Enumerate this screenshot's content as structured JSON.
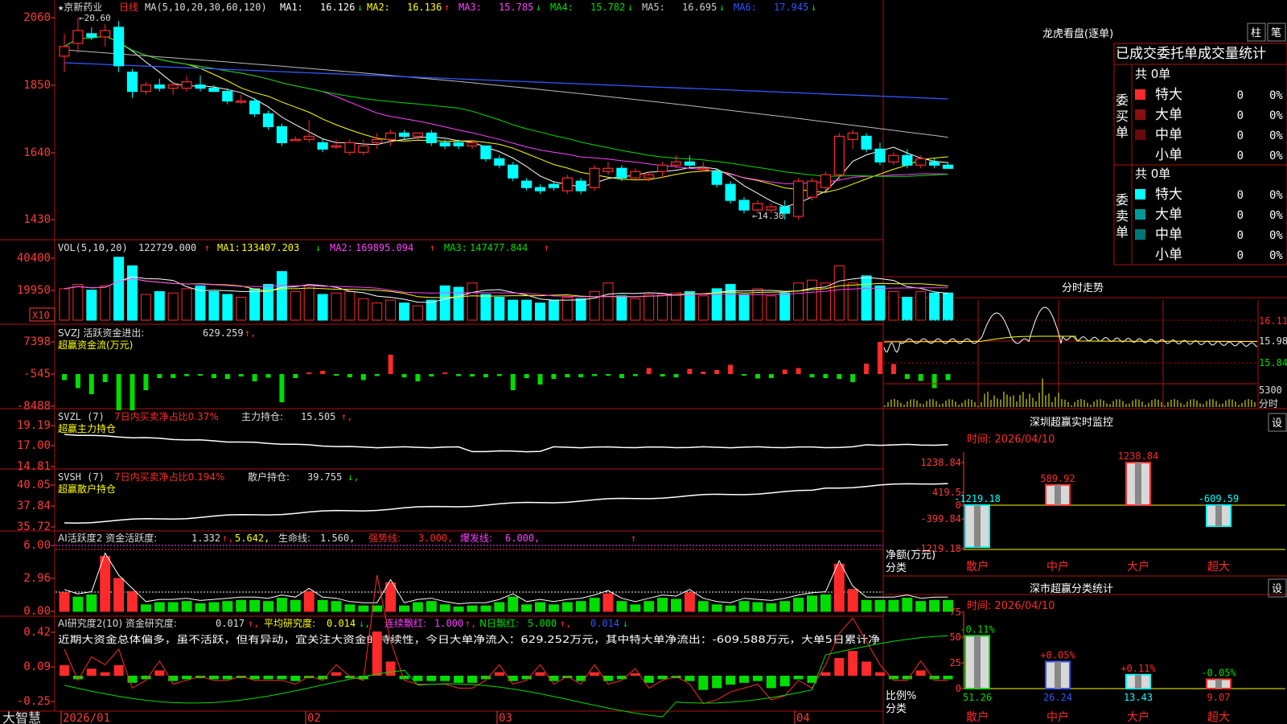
{
  "colors": {
    "red": "#ff2a2a",
    "green": "#00dd00",
    "cyan": "#00ffff",
    "yellow": "#ffff00",
    "magenta": "#ff40ff",
    "white": "#ffffff",
    "blue": "#3355ff",
    "gray": "#aaaaaa",
    "frame": "#b01010",
    "axis": "#ff3a3a"
  },
  "header": {
    "stock": "★京新药业",
    "period": "日线",
    "ma_def": "MA(5,10,20,30,60,120)",
    "ma": [
      {
        "label": "MA1:",
        "value": "16.126",
        "arrow": "↓",
        "color": "#ffffff"
      },
      {
        "label": "MA2:",
        "value": "16.136",
        "arrow": "↑",
        "color": "#ffff00"
      },
      {
        "label": "MA3:",
        "value": "15.785",
        "arrow": "↓",
        "color": "#ff40ff"
      },
      {
        "label": "MA4:",
        "value": "15.782",
        "arrow": "↓",
        "color": "#00dd00"
      },
      {
        "label": "MA5:",
        "value": "16.695",
        "arrow": "↓",
        "color": "#cccccc"
      },
      {
        "label": "MA6:",
        "value": "17.945",
        "arrow": "↓",
        "color": "#3355ff"
      }
    ]
  },
  "price_panel": {
    "ticks": [
      "2060",
      "1850",
      "1640",
      "1430"
    ],
    "high_mark": "←20.60",
    "low_mark": "←14.30"
  },
  "vol_panel": {
    "ticks": [
      "40400",
      "19950"
    ],
    "unit": "X10",
    "title": "VOL(5,10,20)",
    "vol": "122729.000",
    "vol_arrow": "↑",
    "ma": [
      {
        "label": "MA1:",
        "value": "133407.203",
        "arrow": "↓",
        "color": "#ffffff"
      },
      {
        "label": "MA2:",
        "value": "169895.094",
        "arrow": "↑",
        "color": "#ff40ff"
      },
      {
        "label": "MA3:",
        "value": "147477.844",
        "arrow": "↑",
        "color": "#00dd00"
      }
    ]
  },
  "svzj_panel": {
    "ticks": [
      "7398",
      "-545",
      "-8488"
    ],
    "title": "SVZJ  活跃资金进出:",
    "value": "629.259",
    "arrow": "↑,",
    "subtitle": "超赢资金流(万元)"
  },
  "svzl_panel": {
    "ticks": [
      "19.19",
      "17.00",
      "14.81"
    ],
    "title": "SVZL (7)",
    "red_text": "7日内买卖净占比0.37%",
    "label": "主力持仓:",
    "value": "15.505",
    "arrow": "↑,",
    "subtitle": "超赢主力持仓"
  },
  "svsh_panel": {
    "ticks": [
      "40.05",
      "37.84",
      "35.72"
    ],
    "title": "SVSH (7)",
    "red_text": "7日内买卖净占比0.194%",
    "label": "散户持仓:",
    "value": "39.755",
    "arrow": "↓,",
    "subtitle": "超赢散户持仓"
  },
  "ai_panel": {
    "ticks": [
      "6.00",
      "2.96",
      "0.00"
    ],
    "title": "AI活跃度2 资金活跃度:",
    "v1": "1.332",
    "a1": "↑,",
    "v2": "5.642,",
    "label3": "生命线:",
    "v3": "1.560,",
    "l4": "强势线:",
    "v4": "3.000,",
    "l5": "爆发线:",
    "v5": "6.000,",
    "mark": "↑"
  },
  "ai2_panel": {
    "ticks": [
      "0.42",
      "0.09",
      "-0.25"
    ],
    "title": "AI研究度2(10) 资金研究度:",
    "v1": "0.017",
    "a1": "↑,",
    "l2": "平均研究度:",
    "v2": "0.014",
    "a2": "↓,",
    "l3": "连续飘红:",
    "v3": "1.000",
    "a3": "↑,",
    "l4": "N日飘红:",
    "v4": "5.000",
    "a4": "↑,",
    "v5": "0.014",
    "a5": "↓",
    "comment": "近期大资金总体偏多，虽不活跃，但有异动，宜关注大资金的持续性，今日大单净流入：629.252万元，其中特大单净流出：-609.588万元，大单5日累计净"
  },
  "dates": [
    "2026/01",
    "02",
    "03",
    "04"
  ],
  "brand": "大智慧",
  "right": {
    "lhkp_title": "龙虎看盘(逐单)",
    "btn1": "柱",
    "btn2": "笔",
    "stat_title": "已成交委托单成交量统计",
    "buy_total": "共 0单",
    "sell_total": "共 0单",
    "buy_side": [
      "委",
      "买",
      "单"
    ],
    "sell_side": [
      "委",
      "卖",
      "单"
    ],
    "buy_rows": [
      {
        "label": "特大",
        "v": "0",
        "p": "0%",
        "color": "#ff2a2a"
      },
      {
        "label": "大单",
        "v": "0",
        "p": "0%",
        "color": "#8a1010"
      },
      {
        "label": "中单",
        "v": "0",
        "p": "0%",
        "color": "#6a0a0a"
      },
      {
        "label": "小单",
        "v": "0",
        "p": "0%",
        "color": ""
      }
    ],
    "sell_rows": [
      {
        "label": "特大",
        "v": "0",
        "p": "0%",
        "color": "#00ffff"
      },
      {
        "label": "大单",
        "v": "0",
        "p": "0%",
        "color": "#009999"
      },
      {
        "label": "中单",
        "v": "0",
        "p": "0%",
        "color": "#007777"
      },
      {
        "label": "小单",
        "v": "0",
        "p": "0%",
        "color": ""
      }
    ],
    "fs_title": "分时走势",
    "fs_ticks": [
      "16.11",
      "15.98",
      "15.84"
    ],
    "fs_vol": "5300",
    "fs_vol_label": "分时",
    "sz_title": "深圳超赢实时监控",
    "sz_btn": "设",
    "sz_time": "时间: 2026/04/10",
    "sz_ticks": [
      "1238.84",
      "419.5",
      "0",
      "-399.84",
      "-1219.18"
    ],
    "sz_ylabel": "净额(万元)",
    "sz_xlabel": "分类",
    "sz_cats": [
      "散户",
      "中户",
      "大户",
      "超大"
    ],
    "sz_values": [
      -1219.18,
      589.92,
      1238.84,
      -609.59
    ],
    "sz_labels": [
      "-1219.18",
      "589.92",
      "1238.84",
      "-609.59"
    ],
    "fl_title": "深市超赢分类统计",
    "fl_btn": "设",
    "fl_time": "时间: 2026/04/10",
    "fl_ticks": [
      "75",
      "50",
      "25",
      "0"
    ],
    "fl_ylabel": "比例%",
    "fl_xlabel": "分类",
    "fl_cats": [
      "散户",
      "中户",
      "大户",
      "超大"
    ],
    "fl_values": [
      51.26,
      26.24,
      13.43,
      9.07
    ],
    "fl_value_labels": [
      "51.26",
      "26.24",
      "13.43",
      "9.07"
    ],
    "fl_change": [
      "-0.11%",
      "+0.05%",
      "+0.11%",
      "-0.05%"
    ]
  },
  "chart_data": [
    {
      "type": "candlestick",
      "title": "京新药业 日线",
      "ylim": [
        14.0,
        20.8
      ],
      "y_ticks": [
        20.6,
        18.5,
        16.4,
        14.3
      ],
      "ohlc": [
        [
          19.4,
          20.1,
          18.9,
          19.7
        ],
        [
          19.8,
          20.6,
          19.5,
          20.2
        ],
        [
          20.1,
          20.3,
          19.9,
          20.0
        ],
        [
          20.0,
          20.4,
          19.7,
          20.2
        ],
        [
          20.3,
          20.5,
          18.9,
          19.1
        ],
        [
          18.9,
          19.0,
          18.1,
          18.3
        ],
        [
          18.3,
          18.6,
          18.2,
          18.5
        ],
        [
          18.5,
          18.7,
          18.3,
          18.4
        ],
        [
          18.4,
          18.6,
          18.2,
          18.5
        ],
        [
          18.4,
          18.8,
          18.3,
          18.6
        ],
        [
          18.5,
          18.8,
          18.3,
          18.4
        ],
        [
          18.4,
          18.5,
          18.3,
          18.3
        ],
        [
          18.3,
          18.4,
          17.9,
          18.0
        ],
        [
          18.0,
          18.2,
          17.9,
          18.0
        ],
        [
          18.0,
          18.1,
          17.5,
          17.6
        ],
        [
          17.6,
          17.7,
          17.1,
          17.2
        ],
        [
          17.2,
          17.3,
          16.6,
          16.7
        ],
        [
          16.8,
          16.9,
          16.8,
          16.8
        ],
        [
          16.8,
          17.4,
          16.7,
          16.9
        ],
        [
          16.7,
          16.8,
          16.4,
          16.5
        ],
        [
          16.6,
          16.8,
          16.5,
          16.6
        ],
        [
          16.4,
          16.8,
          16.3,
          16.7
        ],
        [
          16.4,
          16.8,
          16.3,
          16.6
        ],
        [
          16.7,
          17.0,
          16.5,
          16.8
        ],
        [
          16.8,
          17.1,
          16.6,
          17.0
        ],
        [
          17.0,
          17.1,
          16.8,
          16.9
        ],
        [
          16.9,
          17.0,
          16.8,
          17.0
        ],
        [
          17.0,
          17.1,
          16.6,
          16.7
        ],
        [
          16.7,
          16.8,
          16.5,
          16.6
        ],
        [
          16.7,
          16.8,
          16.5,
          16.6
        ],
        [
          16.6,
          16.8,
          16.5,
          16.7
        ],
        [
          16.6,
          16.6,
          16.1,
          16.2
        ],
        [
          16.2,
          16.3,
          15.9,
          16.0
        ],
        [
          16.0,
          16.1,
          15.5,
          15.6
        ],
        [
          15.5,
          15.6,
          15.2,
          15.3
        ],
        [
          15.3,
          15.4,
          15.1,
          15.2
        ],
        [
          15.4,
          15.5,
          15.2,
          15.3
        ],
        [
          15.2,
          15.7,
          15.1,
          15.6
        ],
        [
          15.5,
          15.6,
          15.1,
          15.2
        ],
        [
          15.3,
          16.0,
          15.2,
          15.9
        ],
        [
          15.8,
          16.1,
          15.7,
          15.9
        ],
        [
          15.9,
          16.0,
          15.5,
          15.6
        ],
        [
          15.6,
          15.9,
          15.5,
          15.8
        ],
        [
          15.6,
          15.8,
          15.5,
          15.7
        ],
        [
          15.8,
          16.1,
          15.6,
          16.0
        ],
        [
          16.0,
          16.3,
          15.9,
          16.1
        ],
        [
          16.1,
          16.3,
          15.9,
          16.0
        ],
        [
          15.9,
          16.1,
          15.8,
          15.9
        ],
        [
          15.8,
          15.9,
          15.3,
          15.4
        ],
        [
          15.4,
          15.5,
          14.8,
          14.9
        ],
        [
          14.9,
          15.0,
          14.5,
          14.6
        ],
        [
          14.6,
          14.9,
          14.5,
          14.8
        ],
        [
          14.6,
          14.8,
          14.5,
          14.7
        ],
        [
          14.7,
          14.9,
          14.3,
          14.5
        ],
        [
          14.4,
          15.6,
          14.3,
          15.5
        ],
        [
          15.0,
          15.6,
          14.9,
          15.5
        ],
        [
          15.3,
          15.8,
          15.2,
          15.7
        ],
        [
          15.7,
          17.0,
          15.5,
          16.9
        ],
        [
          16.8,
          17.1,
          16.5,
          17.0
        ],
        [
          16.9,
          17.0,
          16.4,
          16.5
        ],
        [
          16.5,
          16.7,
          16.0,
          16.1
        ],
        [
          16.1,
          16.4,
          16.0,
          16.3
        ],
        [
          16.3,
          16.5,
          15.9,
          16.0
        ],
        [
          16.0,
          16.3,
          15.9,
          16.2
        ],
        [
          16.1,
          16.2,
          15.9,
          16.0
        ],
        [
          16.0,
          16.1,
          15.9,
          15.9
        ]
      ]
    },
    {
      "type": "bar",
      "title": "VOL(5,10,20)",
      "ylim": [
        0,
        45000
      ],
      "values": [
        22000,
        25000,
        21000,
        24000,
        44000,
        38000,
        18000,
        20000,
        19000,
        22000,
        24000,
        20000,
        18000,
        16000,
        22000,
        25000,
        34000,
        20000,
        24000,
        18000,
        19000,
        20000,
        15000,
        12000,
        14000,
        12000,
        10000,
        14000,
        24000,
        23000,
        26000,
        18000,
        16000,
        14000,
        14000,
        12000,
        14000,
        16000,
        15000,
        20000,
        26000,
        17000,
        15000,
        18000,
        18000,
        19000,
        20000,
        17000,
        22000,
        25000,
        18000,
        22000,
        17000,
        19000,
        26000,
        28000,
        26000,
        38000,
        26000,
        31000,
        24000,
        20000,
        16000,
        20000,
        19000,
        19000
      ]
    },
    {
      "type": "bar",
      "title": "SVZJ 活跃资金进出",
      "values": [
        -1500,
        -3500,
        -5000,
        -2000,
        -9000,
        -9000,
        -4000,
        -1000,
        -1000,
        -500,
        -400,
        -1000,
        -1200,
        -600,
        -1800,
        -900,
        -7000,
        -1000,
        300,
        800,
        -200,
        -800,
        -1500,
        -500,
        4800,
        -800,
        -1800,
        -600,
        400,
        -500,
        -600,
        -800,
        -500,
        -4000,
        -1000,
        -2600,
        -1200,
        -800,
        -800,
        -500,
        -300,
        -1000,
        -500,
        1500,
        -600,
        -800,
        1300,
        600,
        1000,
        2300,
        -300,
        -1100,
        -1000,
        1100,
        1500,
        -800,
        -1000,
        -1200,
        -2000,
        2600,
        8000,
        2500,
        -1200,
        -1700,
        -3500,
        -1500
      ]
    },
    {
      "type": "line",
      "title": "SVZL 主力持仓",
      "ylim": [
        14.81,
        19.19
      ],
      "last": 15.505
    },
    {
      "type": "line",
      "title": "SVSH 散户持仓",
      "ylim": [
        35.72,
        40.05
      ],
      "last": 39.755
    },
    {
      "type": "bar",
      "title": "AI活跃度2",
      "ylim": [
        0,
        6.5
      ],
      "values": [
        1.7,
        1.3,
        1.5,
        5.0,
        3.0,
        1.8,
        0.6,
        0.8,
        0.8,
        0.9,
        0.7,
        0.8,
        0.9,
        1.0,
        1.0,
        0.9,
        1.2,
        1.0,
        1.8,
        1.0,
        0.9,
        0.6,
        0.5,
        0.5,
        2.6,
        0.5,
        0.8,
        0.9,
        0.6,
        0.4,
        0.5,
        0.5,
        0.8,
        1.3,
        0.6,
        0.8,
        0.6,
        0.8,
        0.9,
        1.2,
        1.6,
        0.9,
        0.6,
        0.9,
        1.2,
        1.1,
        1.7,
        0.9,
        0.6,
        0.5,
        0.9,
        0.8,
        0.7,
        0.9,
        1.2,
        1.4,
        1.5,
        4.3,
        2.0,
        1.0,
        1.0,
        1.0,
        1.2,
        0.9,
        1.0,
        1.0
      ]
    },
    {
      "type": "bar",
      "title": "AI研究度2(10)",
      "ylim": [
        -0.25,
        0.42
      ],
      "values": [
        0.06,
        -0.02,
        0.04,
        0.02,
        0.06,
        -0.04,
        -0.02,
        0.03,
        -0.03,
        -0.02,
        -0.01,
        -0.02,
        -0.02,
        -0.01,
        -0.02,
        -0.02,
        -0.02,
        -0.03,
        -0.01,
        -0.02,
        0.02,
        -0.01,
        -0.02,
        0.25,
        0.08,
        -0.02,
        -0.03,
        -0.03,
        -0.03,
        -0.04,
        -0.04,
        -0.02,
        0.02,
        -0.03,
        -0.02,
        0.02,
        -0.03,
        -0.01,
        -0.03,
        0.02,
        -0.03,
        -0.02,
        0.01,
        -0.04,
        -0.02,
        -0.01,
        -0.03,
        -0.08,
        -0.07,
        -0.05,
        -0.04,
        -0.03,
        -0.07,
        -0.06,
        -0.02,
        -0.04,
        0.02,
        0.1,
        0.14,
        0.08,
        0.02,
        -0.02,
        -0.02,
        0.03,
        -0.02,
        -0.02
      ]
    },
    {
      "type": "bar",
      "title": "深圳超赢实时监控",
      "categories": [
        "散户",
        "中户",
        "大户",
        "超大"
      ],
      "values": [
        -1219.18,
        589.92,
        1238.84,
        -609.59
      ],
      "ylabel": "净额(万元)",
      "xlabel": "分类"
    },
    {
      "type": "bar",
      "title": "深市超赢分类统计",
      "categories": [
        "散户",
        "中户",
        "大户",
        "超大"
      ],
      "values": [
        51.26,
        26.24,
        13.43,
        9.07
      ],
      "ylabel": "比例%",
      "xlabel": "分类"
    }
  ]
}
